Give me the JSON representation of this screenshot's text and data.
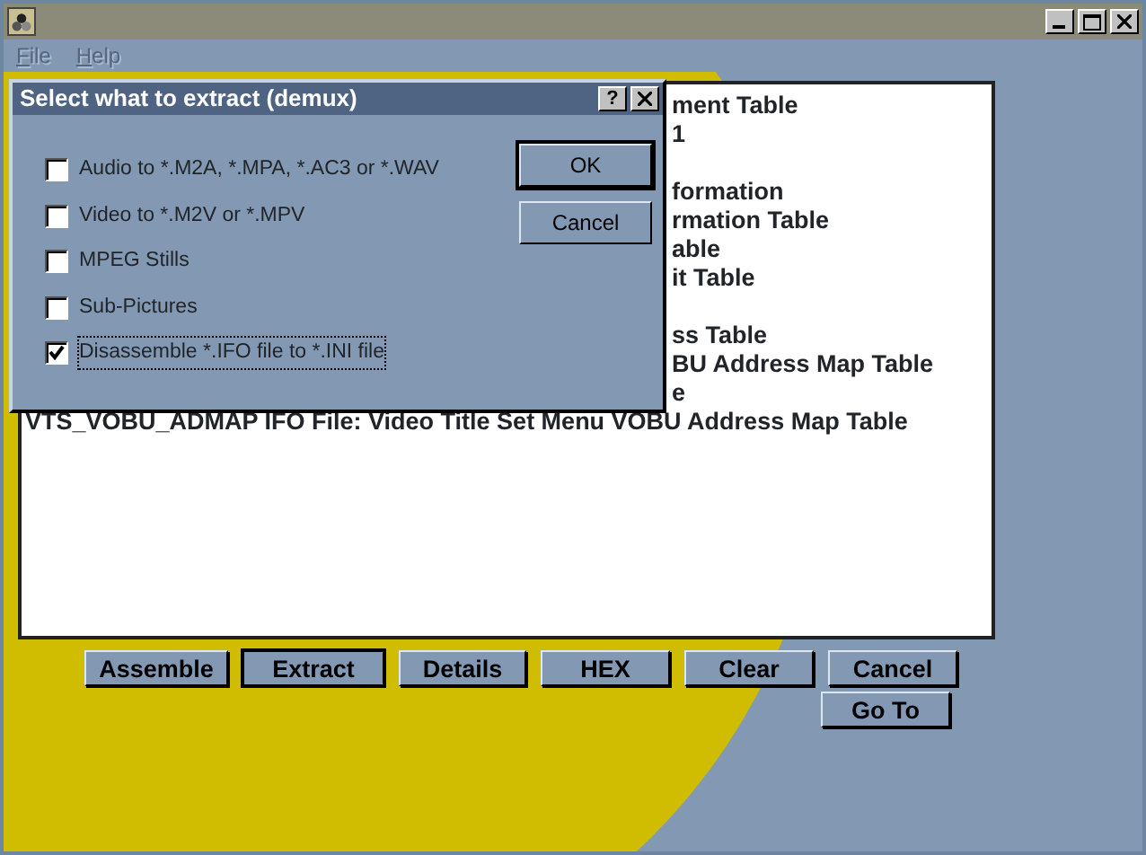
{
  "window": {
    "menu": [
      {
        "label": "File"
      },
      {
        "label": "Help"
      }
    ]
  },
  "listbox": {
    "lines": [
      {
        "kind": "partial",
        "text": "ment Table"
      },
      {
        "kind": "partial",
        "text": "1"
      },
      {
        "kind": "blank"
      },
      {
        "kind": "partial",
        "text": "formation"
      },
      {
        "kind": "partial",
        "text": "rmation Table"
      },
      {
        "kind": "partial",
        "text": "able"
      },
      {
        "kind": "partial",
        "text": "it Table"
      },
      {
        "kind": "blank"
      },
      {
        "kind": "partial",
        "text": "ss Table"
      },
      {
        "kind": "partial",
        "text": "BU Address Map Table"
      },
      {
        "kind": "partial",
        "text": "e"
      },
      {
        "kind": "full",
        "text": "VTS_VOBU_ADMAP IFO File: Video Title Set Menu VOBU Address Map Table"
      }
    ]
  },
  "buttons": [
    {
      "label": "Assemble",
      "focused": false
    },
    {
      "label": "Extract",
      "focused": true
    },
    {
      "label": "Details",
      "focused": false
    },
    {
      "label": "HEX",
      "focused": false
    },
    {
      "label": "Clear",
      "focused": false
    },
    {
      "label": "Cancel",
      "focused": false
    }
  ],
  "goto_button": {
    "label": "Go To"
  },
  "dialog": {
    "title": "Select what to extract (demux)",
    "help": "?",
    "options": [
      {
        "label": "Audio to *.M2A, *.MPA, *.AC3 or *.WAV",
        "checked": false,
        "focused": false
      },
      {
        "label": "Video to *.M2V or *.MPV",
        "checked": false,
        "focused": false
      },
      {
        "label": "MPEG Stills",
        "checked": false,
        "focused": false
      },
      {
        "label": "Sub-Pictures",
        "checked": false,
        "focused": false
      },
      {
        "label": "Disassemble *.IFO file to *.INI file",
        "checked": true,
        "focused": true
      }
    ],
    "buttons": [
      {
        "label": "OK",
        "default": true
      },
      {
        "label": "Cancel",
        "default": false
      }
    ]
  }
}
